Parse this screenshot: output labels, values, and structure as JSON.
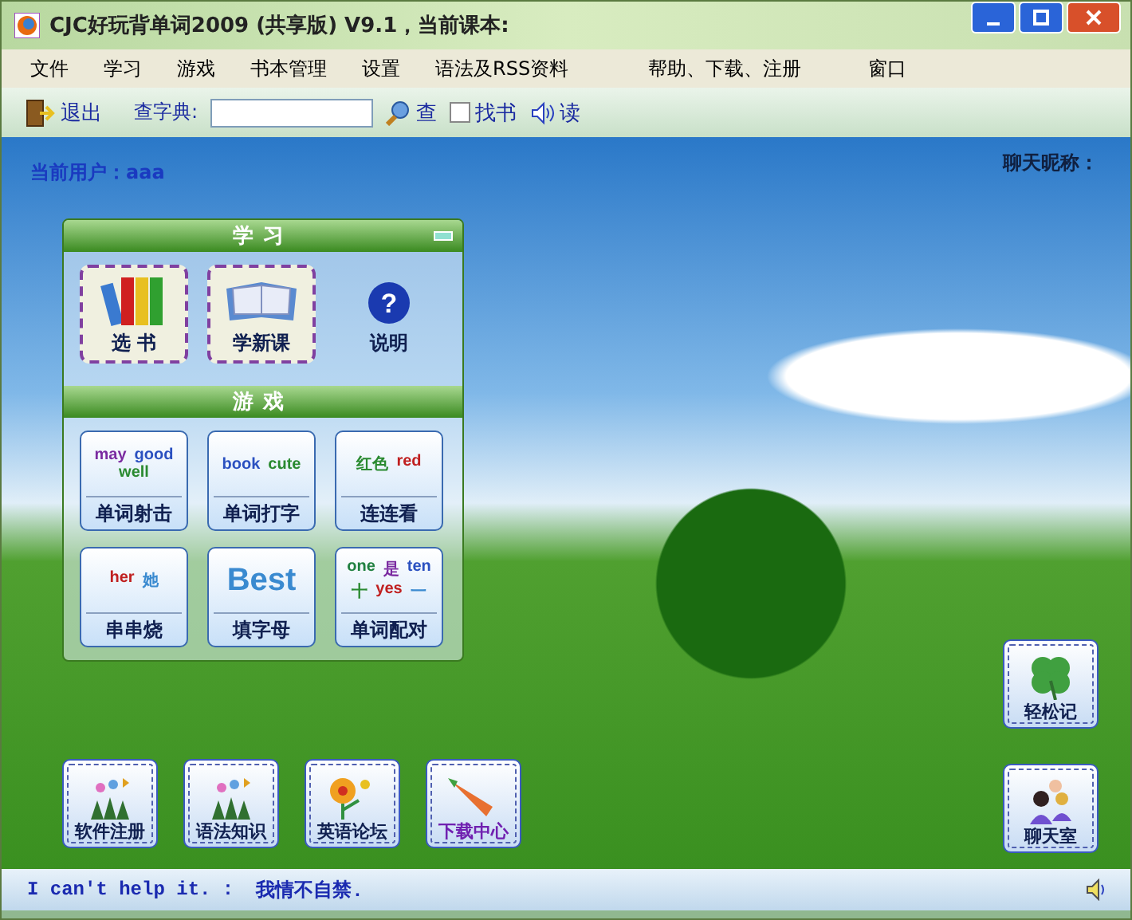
{
  "window": {
    "title": "CJC好玩背单词2009 (共享版) V9.1，当前课本:"
  },
  "menu": [
    "文件",
    "学习",
    "游戏",
    "书本管理",
    "设置",
    "语法及RSS资料",
    "帮助、下载、注册",
    "窗口"
  ],
  "toolbar": {
    "exit": "退出",
    "dict_label": "查字典:",
    "lookup": "查",
    "find_book": {
      "label": "找书",
      "checked": false
    },
    "read": "读"
  },
  "user": {
    "label": "当前用户：",
    "name": "aaa"
  },
  "chat_nick": "聊天昵称：",
  "panel": {
    "title": "学习",
    "study": [
      {
        "label": "选 书",
        "kind": "books"
      },
      {
        "label": "学新课",
        "kind": "book"
      },
      {
        "label": "说明",
        "kind": "help",
        "icon": "?"
      }
    ],
    "games_title": "游戏",
    "games": [
      {
        "label": "单词射击",
        "kind": "shoot",
        "words": [
          "may",
          "good",
          "well"
        ]
      },
      {
        "label": "单词打字",
        "kind": "type",
        "words": [
          "book",
          "cute"
        ]
      },
      {
        "label": "连连看",
        "kind": "link",
        "words": [
          "红色",
          "red"
        ]
      },
      {
        "label": "串串烧",
        "kind": "skewer",
        "words": [
          "her",
          "她"
        ]
      },
      {
        "label": "填字母",
        "kind": "fill",
        "words": [
          "Best"
        ]
      },
      {
        "label": "单词配对",
        "kind": "pair",
        "words": [
          "one",
          "是",
          "ten",
          "十",
          "yes",
          "一"
        ]
      }
    ]
  },
  "bottom_buttons": [
    {
      "label": "软件注册",
      "kind": "butterfly",
      "highlighted": false
    },
    {
      "label": "语法知识",
      "kind": "flowers",
      "highlighted": false
    },
    {
      "label": "英语论坛",
      "kind": "flower",
      "highlighted": false
    },
    {
      "label": "下载中心",
      "kind": "carrot",
      "highlighted": true
    }
  ],
  "side_buttons": [
    {
      "label": "轻松记",
      "kind": "clover"
    },
    {
      "label": "聊天室",
      "kind": "people"
    }
  ],
  "status": {
    "english": "I can't help it. :",
    "chinese": "我情不自禁."
  }
}
